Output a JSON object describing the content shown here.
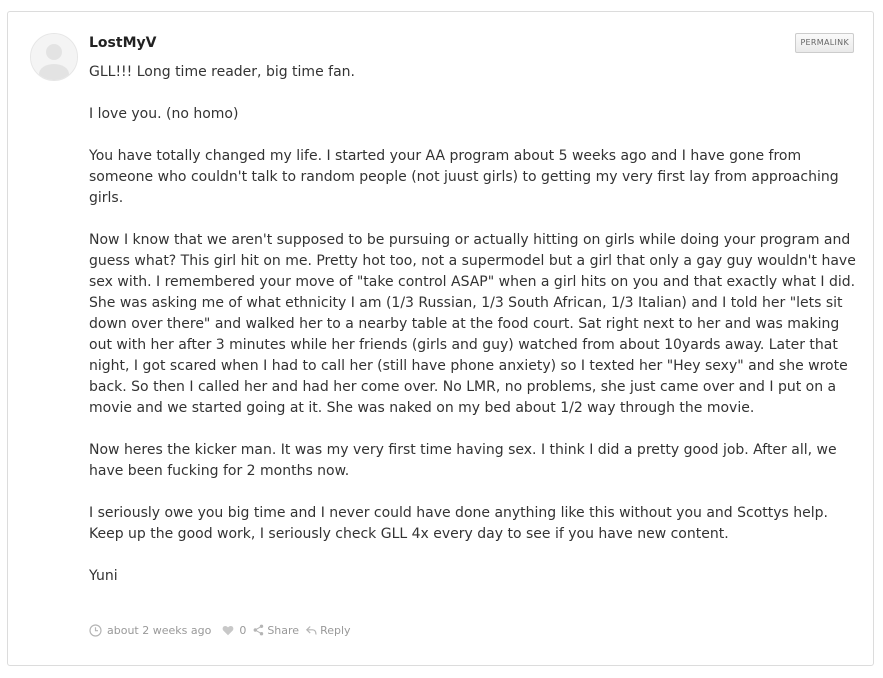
{
  "comment": {
    "author": "LostMyV",
    "permalink_label": "PERMALINK",
    "paragraphs": [
      "GLL!!! Long time reader, big time fan.",
      "I love you. (no homo)",
      "You have totally changed my life. I started your AA program about 5 weeks ago and I have gone from someone who couldn't talk to random people (not juust girls) to getting my very first lay from approaching girls.",
      "Now I know that we aren't supposed to be pursuing or actually hitting on girls while doing your program and guess what? This girl hit on me. Pretty hot too, not a supermodel but a girl that only a gay guy wouldn't have sex with. I remembered your move of \"take control ASAP\" when a girl hits on you and that exactly what I did. She was asking me of what ethnicity I am (1/3 Russian, 1/3 South African, 1/3 Italian) and I told her \"lets sit down over there\" and walked her to a nearby table at the food court. Sat right next to her and was making out with her after 3 minutes while her friends (girls and guy) watched from about 10yards away. Later that night, I got scared when I had to call her (still have phone anxiety) so I texted her \"Hey sexy\" and she wrote back. So then I called her and had her come over. No LMR, no problems, she just came over and I put on a movie and we started going at it. She was naked on my bed about 1/2 way through the movie.",
      "Now heres the kicker man. It was my very first time having sex. I think I did a pretty good job. After all, we have been fucking for 2 months now.",
      "I seriously owe you big time and I never could have done anything like this without you and Scottys help. Keep up the good work, I seriously check GLL 4x every day to see if you have new content.",
      "Yuni"
    ],
    "meta": {
      "timestamp": "about 2 weeks ago",
      "likes": "0",
      "share_label": "Share",
      "reply_label": "Reply"
    }
  },
  "icons": {
    "clock": "clock-icon",
    "heart": "heart-icon",
    "share": "share-icon",
    "reply": "reply-icon"
  },
  "colors": {
    "meta_text": "#999999",
    "body_text": "#333333",
    "author_text": "#222222",
    "border": "#dcdcdc"
  }
}
